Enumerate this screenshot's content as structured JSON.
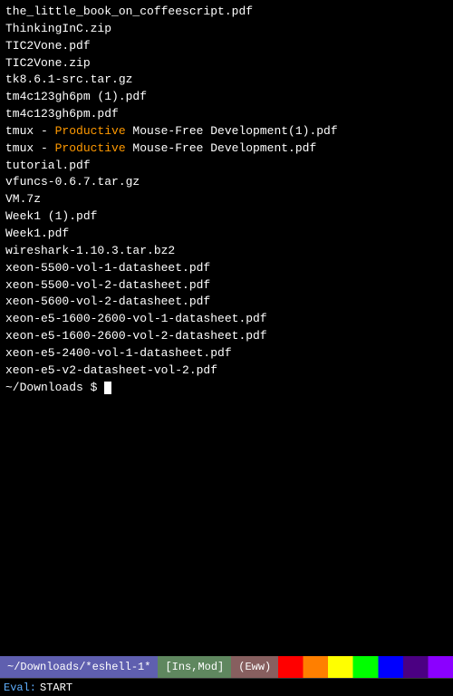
{
  "terminal": {
    "files": [
      "the_little_book_on_coffeescript.pdf",
      "ThinkingInC.zip",
      "TIC2Vone.pdf",
      "TIC2Vone.zip",
      "tk8.6.1-src.tar.gz",
      "tm4c123gh6pm (1).pdf",
      "tm4c123gh6pm.pdf",
      "tmux - Productive Mouse-Free Development(1).pdf",
      "tmux - Productive Mouse-Free Development.pdf",
      "tutorial.pdf",
      "vfuncs-0.6.7.tar.gz",
      "VM.7z",
      "Week1 (1).pdf",
      "Week1.pdf",
      "wireshark-1.10.3.tar.bz2",
      "xeon-5500-vol-1-datasheet.pdf",
      "xeon-5500-vol-2-datasheet.pdf",
      "xeon-5600-vol-2-datasheet.pdf",
      "xeon-e5-1600-2600-vol-1-datasheet.pdf",
      "xeon-e5-1600-2600-vol-2-datasheet.pdf",
      "xeon-e5-2400-vol-1-datasheet.pdf",
      "xeon-e5-v2-datasheet-vol-2.pdf"
    ],
    "prompt": "~/Downloads $ ",
    "highlight_word": "Productive"
  },
  "status_bar": {
    "path": "~/Downloads/*eshell-1*",
    "mode": "[Ins,Mod]",
    "extra": "(Eww)"
  },
  "eval_bar": {
    "label": "Eval:",
    "value": "START"
  }
}
